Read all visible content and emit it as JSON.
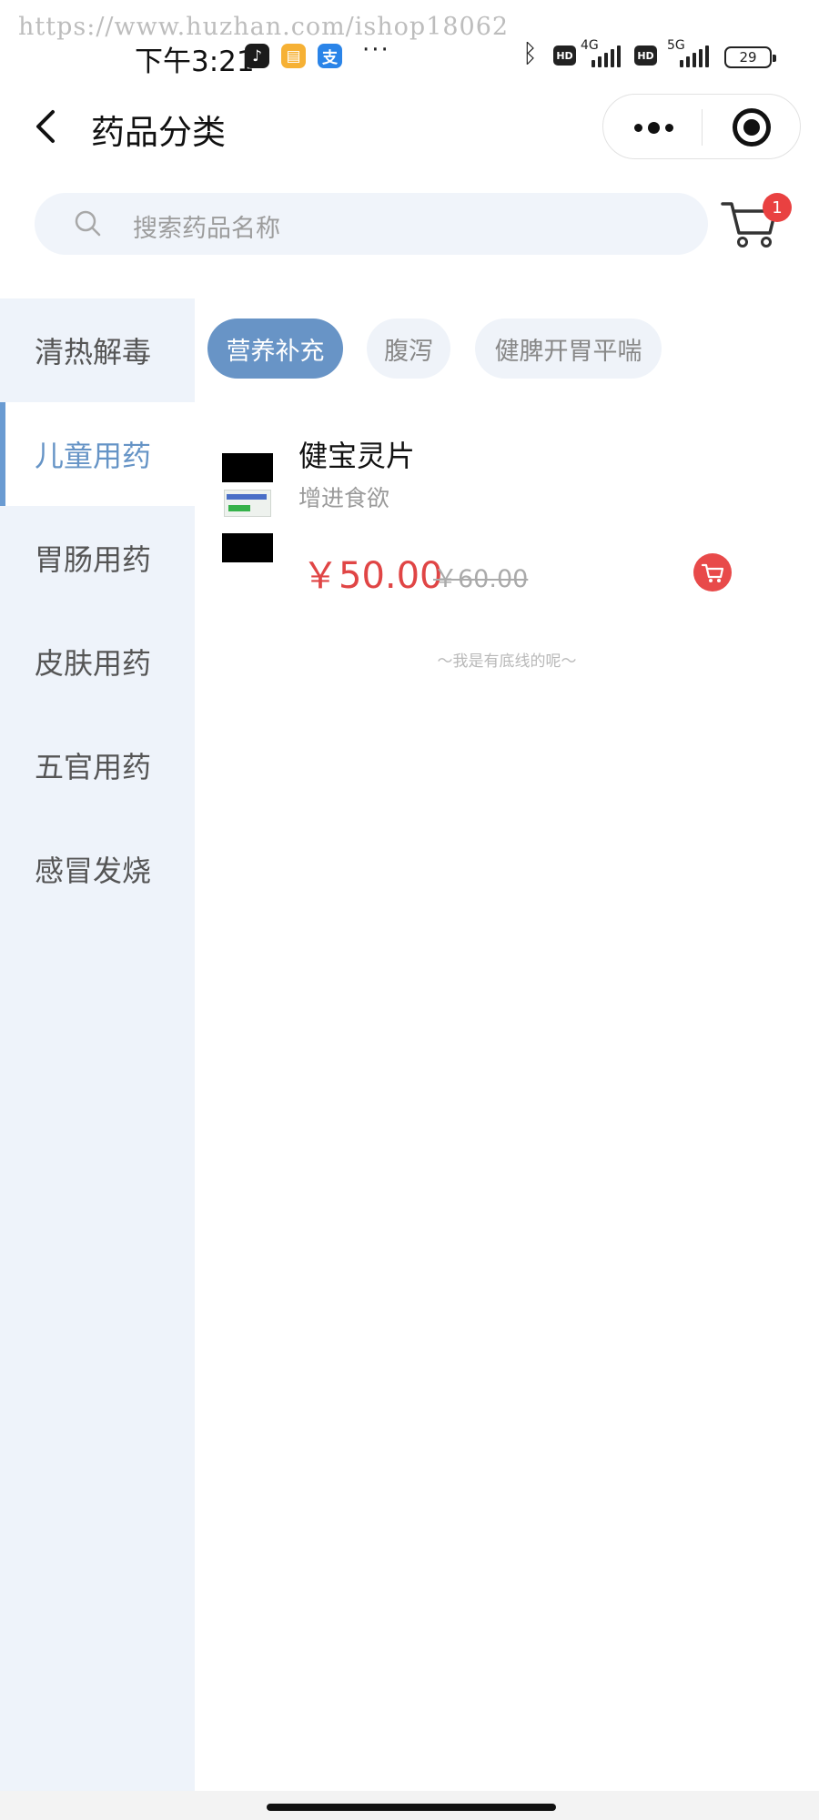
{
  "watermark": "https://www.huzhan.com/ishop18062",
  "status_bar": {
    "time": "下午3:21",
    "app_icons": [
      "tiktok-icon",
      "orange-app-icon",
      "alipay-icon"
    ],
    "alipay_glyph": "支",
    "more": "···",
    "network_1": "4G",
    "network_2": "5G",
    "hd_1": "HD",
    "hd_2": "HD",
    "battery": "29"
  },
  "nav": {
    "title": "药品分类"
  },
  "search": {
    "placeholder": "搜索药品名称"
  },
  "cart": {
    "badge": "1"
  },
  "sidebar": {
    "active_index": 1,
    "items": [
      {
        "label": "清热解毒"
      },
      {
        "label": "儿童用药"
      },
      {
        "label": "胃肠用药"
      },
      {
        "label": "皮肤用药"
      },
      {
        "label": "五官用药"
      },
      {
        "label": "感冒发烧"
      }
    ]
  },
  "tags": [
    {
      "label": "营养补充",
      "active": true
    },
    {
      "label": "腹泻",
      "active": false
    },
    {
      "label": "健脾开胃平喘",
      "active": false
    }
  ],
  "products": [
    {
      "name": "健宝灵片",
      "desc": "增进食欲",
      "price": "￥50.00",
      "original_price": "￥60.00"
    }
  ],
  "list_end_text": "～我是有底线的呢～",
  "colors": {
    "accent": "#6894c6",
    "sidebar_bg": "#eef3fa",
    "price": "#e04545",
    "badge": "#e94141"
  }
}
